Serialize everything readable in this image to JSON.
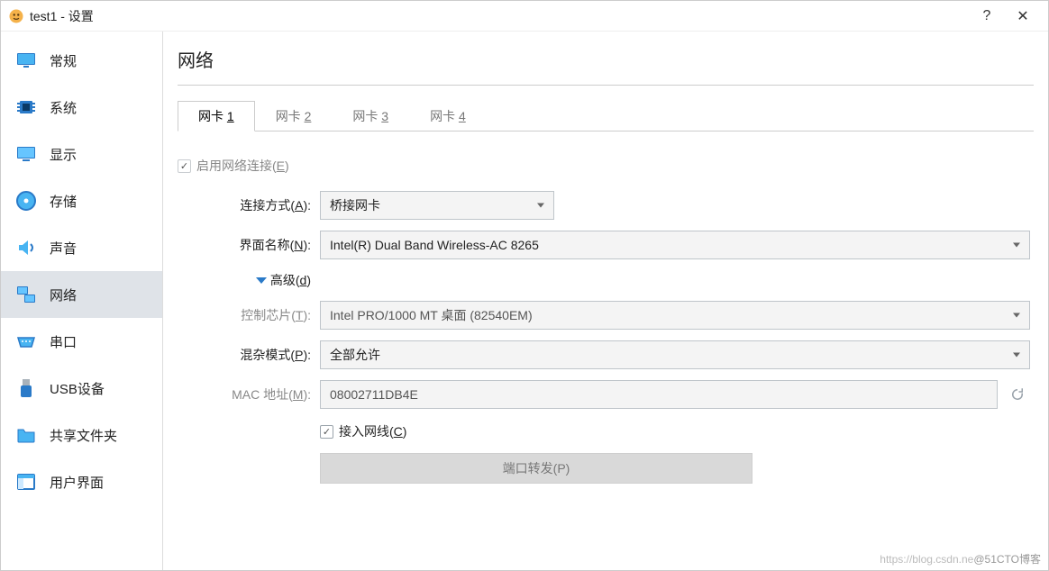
{
  "window_title": "test1 - 设置",
  "titlebar": {
    "help": "?",
    "close": "✕"
  },
  "sidebar": {
    "items": [
      {
        "id": "general",
        "label": "常规"
      },
      {
        "id": "system",
        "label": "系统"
      },
      {
        "id": "display",
        "label": "显示"
      },
      {
        "id": "storage",
        "label": "存储"
      },
      {
        "id": "audio",
        "label": "声音"
      },
      {
        "id": "network",
        "label": "网络"
      },
      {
        "id": "serial",
        "label": "串口"
      },
      {
        "id": "usb",
        "label": "USB设备"
      },
      {
        "id": "shared",
        "label": "共享文件夹"
      },
      {
        "id": "ui",
        "label": "用户界面"
      }
    ],
    "active": "network"
  },
  "page": {
    "title": "网络"
  },
  "tabs": {
    "items": [
      {
        "prefix": "网卡 ",
        "key": "1"
      },
      {
        "prefix": "网卡 ",
        "key": "2"
      },
      {
        "prefix": "网卡 ",
        "key": "3"
      },
      {
        "prefix": "网卡 ",
        "key": "4"
      }
    ],
    "active": 0
  },
  "form": {
    "enable_network": {
      "label_prefix": "启用网络连接(",
      "hotkey": "E",
      "label_suffix": ")",
      "checked": true,
      "muted": true
    },
    "attached_to": {
      "label_prefix": "连接方式(",
      "hotkey": "A",
      "label_suffix": "):",
      "value": "桥接网卡"
    },
    "adapter_name": {
      "label_prefix": "界面名称(",
      "hotkey": "N",
      "label_suffix": "):",
      "value": "Intel(R) Dual Band Wireless-AC 8265"
    },
    "advanced": {
      "label_prefix": "高级(",
      "hotkey": "d",
      "label_suffix": ")"
    },
    "adapter_type": {
      "label_prefix": "控制芯片(",
      "hotkey": "T",
      "label_suffix": "):",
      "value": "Intel PRO/1000 MT 桌面 (82540EM)",
      "disabled": true
    },
    "promiscuous": {
      "label_prefix": "混杂模式(",
      "hotkey": "P",
      "label_suffix": "):",
      "value": "全部允许"
    },
    "mac_address": {
      "label_prefix": "MAC 地址(",
      "hotkey": "M",
      "label_suffix": "):",
      "value": "08002711DB4E"
    },
    "cable_connected": {
      "label_prefix": "接入网线(",
      "hotkey": "C",
      "label_suffix": ")",
      "checked": true
    },
    "port_forwarding": {
      "label_prefix": "端口转发(",
      "hotkey": "P",
      "label_suffix": ")"
    }
  },
  "watermark": {
    "left": "https://blog.csdn.ne",
    "right": "@51CTO博客"
  }
}
